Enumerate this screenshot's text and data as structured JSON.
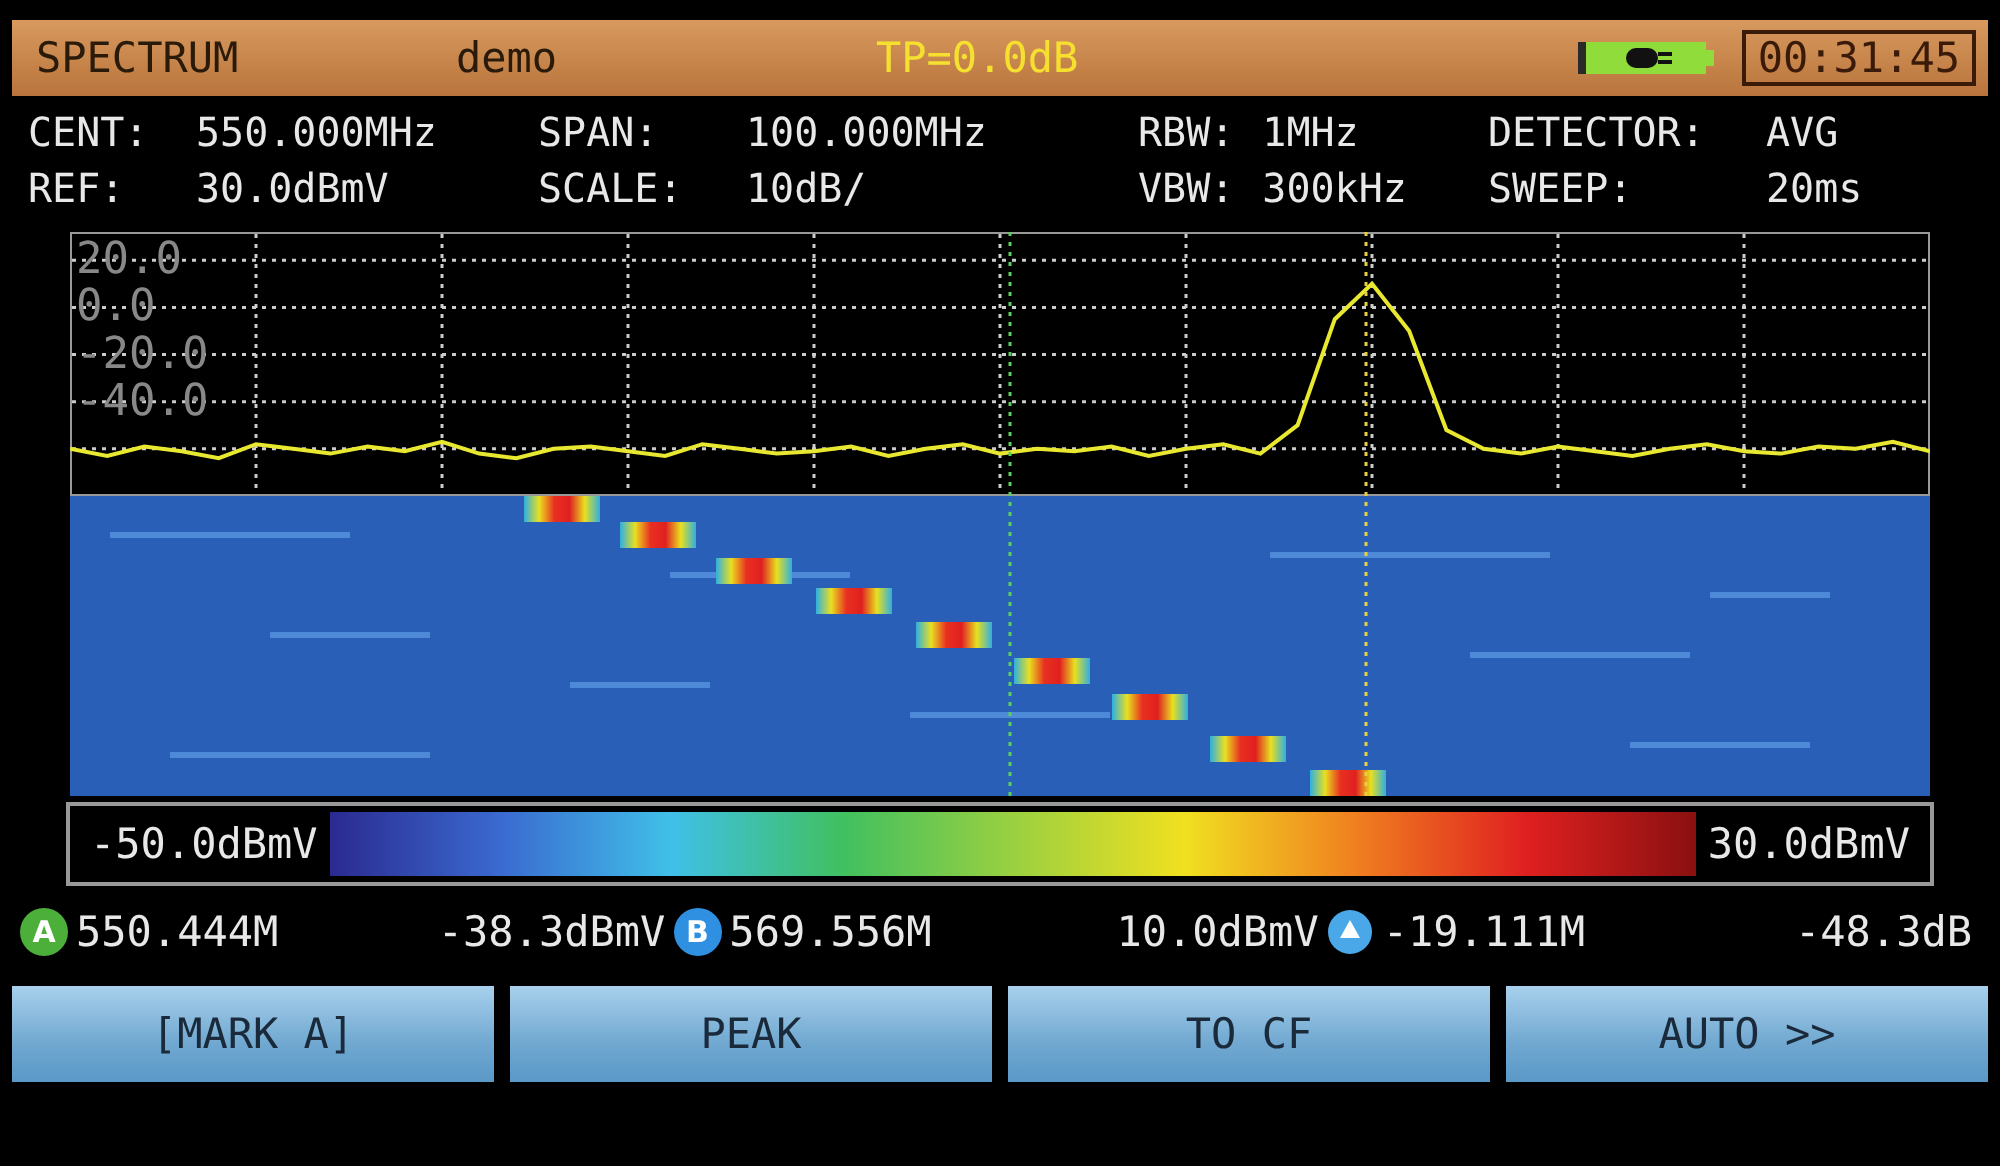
{
  "header": {
    "mode": "SPECTRUM",
    "label": "demo",
    "tp": "TP=0.0dB",
    "time": "00:31:45"
  },
  "settings": [
    {
      "label": "CENT:",
      "value": "550.000MHz"
    },
    {
      "label": "SPAN:",
      "value": "100.000MHz"
    },
    {
      "label": "RBW:",
      "value": "1MHz"
    },
    {
      "label": "DETECTOR:",
      "value": "AVG"
    },
    {
      "label": "REF:",
      "value": "30.0dBmV"
    },
    {
      "label": "SCALE:",
      "value": "10dB/"
    },
    {
      "label": "VBW:",
      "value": "300kHz"
    },
    {
      "label": "SWEEP:",
      "value": "20ms"
    }
  ],
  "spectrum": {
    "chart_data": {
      "type": "line",
      "grid": true,
      "ylim": [
        -80,
        32
      ],
      "yticks": [
        {
          "value": 20,
          "label": "20.0"
        },
        {
          "value": 0,
          "label": "0.0"
        },
        {
          "value": -20,
          "label": "-20.0"
        },
        {
          "value": -40,
          "label": "-40.0"
        }
      ],
      "categories": [
        null,
        null,
        null,
        null,
        null,
        null,
        null,
        null,
        null,
        null,
        null,
        null,
        null,
        null,
        null,
        null,
        null,
        null,
        null,
        null,
        null,
        null,
        null,
        null,
        null,
        null,
        null,
        null,
        null,
        null,
        null,
        null,
        null,
        null,
        null,
        null,
        null,
        null,
        null,
        null,
        null,
        null,
        null,
        null,
        null,
        null,
        null,
        null,
        null,
        null,
        null
      ],
      "series": [
        {
          "color": "#e8e830",
          "values": [
            -60,
            -63,
            -59,
            -61,
            -64,
            -58,
            -60,
            -62,
            -59,
            -61,
            -57,
            -62,
            -64,
            -60,
            -59,
            -61,
            -63,
            -58,
            -60,
            -62,
            -61,
            -59,
            -63,
            -60,
            -58,
            -62,
            -60,
            -61,
            -59,
            -63,
            -60,
            -58,
            -62,
            -50,
            -5,
            10,
            -10,
            -52,
            -60,
            -62,
            -59,
            -61,
            -63,
            -60,
            -58,
            -61,
            -62,
            -59,
            -60,
            -57,
            -61
          ]
        }
      ]
    }
  },
  "color_scale": {
    "min": "-50.0dBmV",
    "max": "30.0dBmV"
  },
  "markers": [
    {
      "kind": "letter",
      "badge": "A",
      "color": "#4caf3a",
      "frequency": "550.444M",
      "level": "-38.3dBmV"
    },
    {
      "kind": "letter",
      "badge": "B",
      "color": "#2f8fe0",
      "frequency": "569.556M",
      "level": "10.0dBmV"
    },
    {
      "kind": "delta",
      "color": "#4aa8e8",
      "frequency": "-19.111M",
      "level": "-48.3dB"
    }
  ],
  "softkeys": [
    "[MARK A]",
    "PEAK",
    "TO CF",
    "AUTO >>"
  ]
}
